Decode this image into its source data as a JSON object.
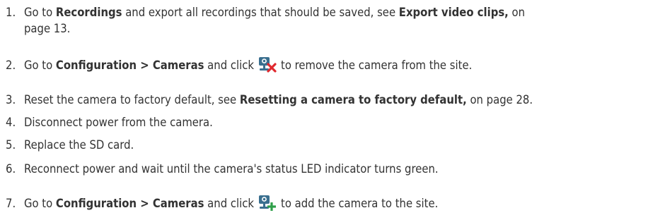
{
  "steps": [
    {
      "num": "1.",
      "line1_a": "Go to ",
      "line1_b": "Recordings",
      "line1_c": " and export all recordings that should be saved, see ",
      "line1_d": "Export video clips,",
      "line1_e": " on",
      "line2": "page 13."
    },
    {
      "num": "2.",
      "a": "Go to ",
      "b": "Configuration > Cameras",
      "c": " and click",
      "icon": "remove-camera-icon",
      "d": "to remove the camera from the site."
    },
    {
      "num": "3.",
      "a": "Reset the camera to factory default, see ",
      "b": "Resetting a camera to factory default,",
      "c": " on page 28."
    },
    {
      "num": "4.",
      "a": "Disconnect power from the camera."
    },
    {
      "num": "5.",
      "a": "Replace the SD card."
    },
    {
      "num": "6.",
      "a": "Reconnect power and wait until the camera's status LED indicator turns green."
    },
    {
      "num": "7.",
      "a": "Go to ",
      "b": "Configuration > Cameras",
      "c": " and click",
      "icon": "add-camera-icon",
      "d": "to add the camera to the site."
    }
  ],
  "colors": {
    "text": "#333333",
    "icon_blue": "#3a6f8f",
    "remove_red": "#e0282e",
    "add_green": "#2fa04a"
  }
}
